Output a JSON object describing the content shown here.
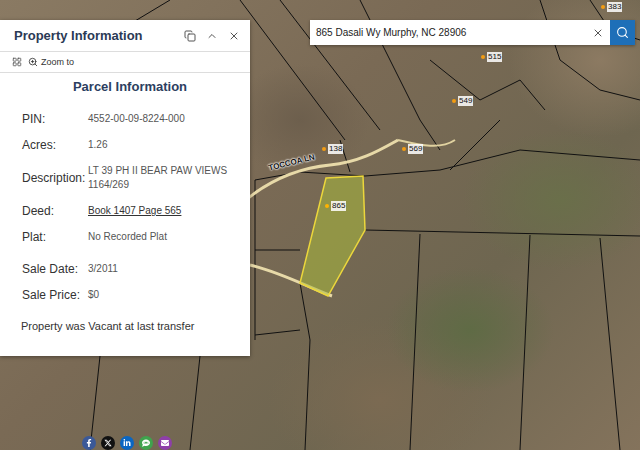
{
  "search": {
    "value": "865 Dasali Wy Murphy, NC 28906"
  },
  "panel": {
    "title": "Property Information",
    "zoom_to": "Zoom to",
    "section": "Parcel Information",
    "fields": [
      {
        "label": "PIN:",
        "value": "4552-00-09-8224-000",
        "link": false
      },
      {
        "label": "Acres:",
        "value": "1.26",
        "link": false
      },
      {
        "label": "Description:",
        "value": "LT 39 PH II BEAR PAW VIEWS 1164/269",
        "link": false
      },
      {
        "label": "Deed:",
        "value": "Book 1407 Page 565",
        "link": true
      },
      {
        "label": "Plat:",
        "value": "No Recorded Plat",
        "link": false
      }
    ],
    "sale_fields": [
      {
        "label": "Sale Date:",
        "value": "3/2011",
        "link": false
      },
      {
        "label": "Sale Price:",
        "value": "$0",
        "link": false
      }
    ],
    "note": "Property was Vacant at last transfer"
  },
  "map": {
    "road_labels": [
      {
        "text": "TOCCOA LN"
      }
    ],
    "address_labels": [
      {
        "text": "138",
        "selected": false
      },
      {
        "text": "569",
        "selected": false
      },
      {
        "text": "865",
        "selected": true
      },
      {
        "text": "549",
        "selected": false
      },
      {
        "text": "515",
        "selected": false
      },
      {
        "text": "383",
        "selected": false
      }
    ]
  },
  "share": [
    {
      "name": "facebook",
      "color": "#3b5998"
    },
    {
      "name": "x",
      "color": "#111111"
    },
    {
      "name": "linkedin",
      "color": "#0a66c2"
    },
    {
      "name": "sms",
      "color": "#3fa34d"
    },
    {
      "name": "email",
      "color": "#8e3fa8"
    }
  ]
}
